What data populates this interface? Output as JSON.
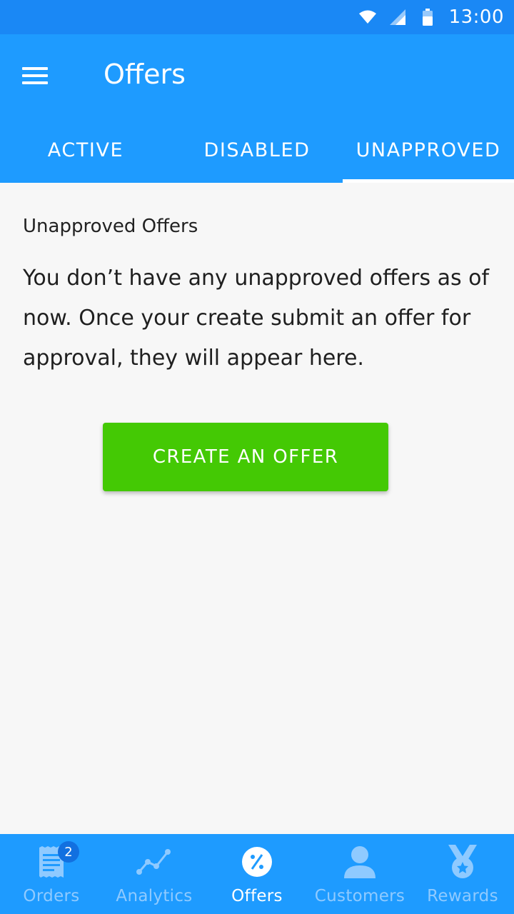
{
  "status_bar": {
    "time": "13:00",
    "icons": [
      "wifi-icon",
      "cellular-signal-icon",
      "battery-icon"
    ]
  },
  "app_bar": {
    "title": "Offers",
    "menu_icon": "menu-icon"
  },
  "tabs": [
    {
      "label": "ACTIVE",
      "selected": false
    },
    {
      "label": "DISABLED",
      "selected": false
    },
    {
      "label": "UNAPPROVED",
      "selected": true
    }
  ],
  "content": {
    "section_label": "Unapproved Offers",
    "message": "You don’t have any unapproved offers as of now. Once your create submit an offer for approval, they will appear here.",
    "cta_label": "CREATE AN OFFER"
  },
  "bottom_nav": {
    "items": [
      {
        "label": "Orders",
        "icon": "receipt-icon",
        "badge": "2",
        "active": false
      },
      {
        "label": "Analytics",
        "icon": "analytics-icon",
        "active": false
      },
      {
        "label": "Offers",
        "icon": "offer-percent-icon",
        "active": true
      },
      {
        "label": "Customers",
        "icon": "person-icon",
        "active": false
      },
      {
        "label": "Rewards",
        "icon": "medal-icon",
        "active": false
      }
    ]
  },
  "colors": {
    "status_bar": "#1a88f5",
    "primary": "#1e9bff",
    "cta": "#44c904",
    "nav_inactive": "#8fcaff",
    "background": "#f7f7f7"
  }
}
